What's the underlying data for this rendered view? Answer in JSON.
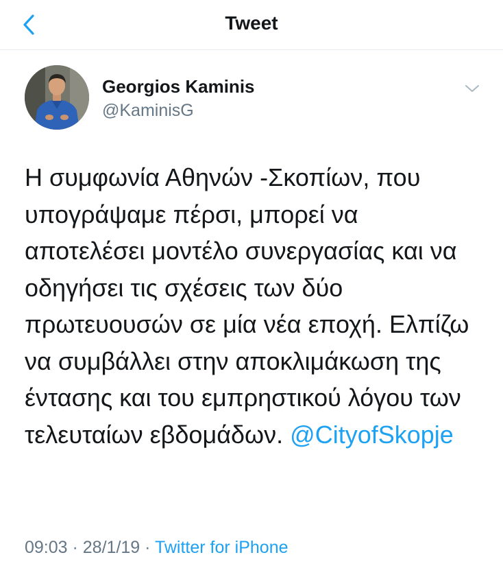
{
  "header": {
    "title": "Tweet",
    "back_icon": "chevron-left-icon"
  },
  "colors": {
    "accent": "#1da1f2",
    "text": "#14171a",
    "secondary": "#657786",
    "divider": "#e6ecf0"
  },
  "author": {
    "name": "Georgios Kaminis",
    "handle": "@KaminisG",
    "menu_icon": "chevron-down-icon"
  },
  "tweet": {
    "text": "Η συμφωνία Αθηνών -Σκοπίων, που υπογράψαμε πέρσι, μπορεί να αποτελέσει μοντέλο συνεργασίας και να οδηγήσει τις σχέσεις των δύο πρωτευουσών σε μία νέα εποχή. Ελπίζω να συμβάλλει στην αποκλιμάκωση της έντασης και του εμπρηστικού λόγου των τελευταίων εβδομάδων. ",
    "mention": "@CityofSkopje"
  },
  "meta": {
    "time": "09:03",
    "separator1": " · ",
    "date": "28/1/19",
    "separator2": " · ",
    "source": "Twitter for iPhone"
  }
}
